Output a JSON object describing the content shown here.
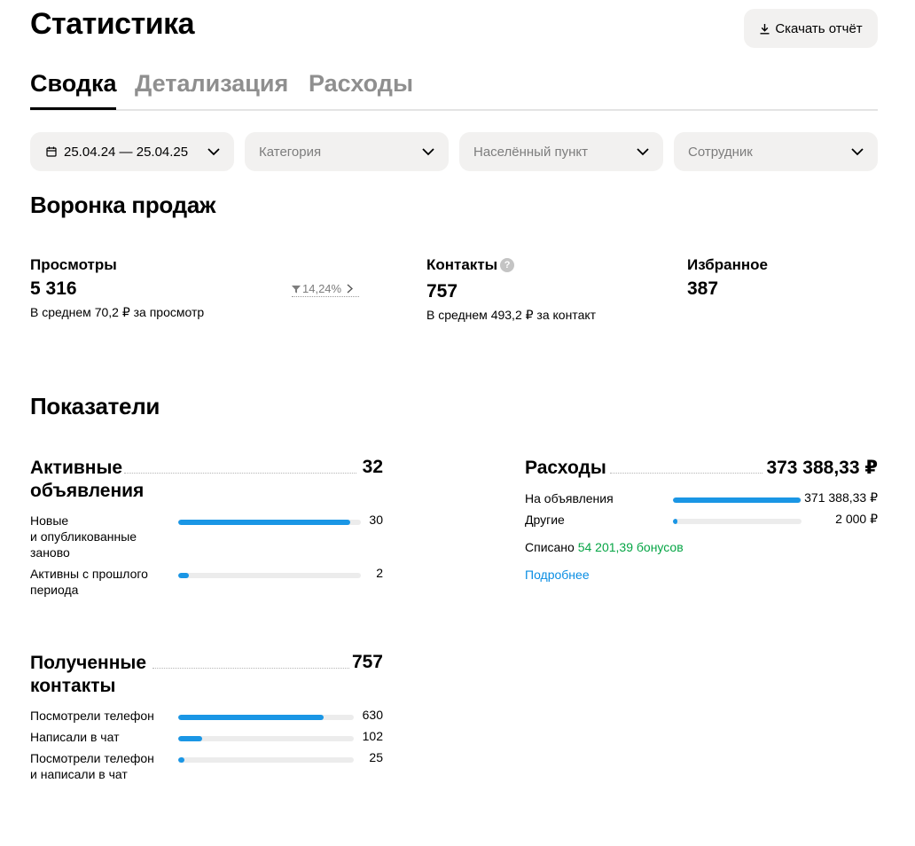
{
  "header": {
    "title": "Статистика",
    "download_label": "Скачать отчёт"
  },
  "tabs": [
    {
      "label": "Сводка",
      "active": true
    },
    {
      "label": "Детализация",
      "active": false
    },
    {
      "label": "Расходы",
      "active": false
    }
  ],
  "filters": {
    "period": "25.04.24 — 25.04.25",
    "category_placeholder": "Категория",
    "city_placeholder": "Населённый пункт",
    "employee_placeholder": "Сотрудник"
  },
  "funnel": {
    "title": "Воронка продаж",
    "views": {
      "label": "Просмотры",
      "value": "5 316",
      "sub": "В среднем 70,2 ₽ за просмотр",
      "conversion": "14,24%"
    },
    "contacts": {
      "label": "Контакты",
      "value": "757",
      "sub": "В среднем 493,2 ₽ за контакт"
    },
    "favorites": {
      "label": "Избранное",
      "value": "387"
    }
  },
  "indicators": {
    "title": "Показатели",
    "active_ads": {
      "title_line1": "Активные",
      "title_line2": "объявления",
      "value": "32",
      "rows": [
        {
          "label_line1": "Новые",
          "label_line2": "и опубликованные",
          "label_line3": "заново",
          "value": "30",
          "share": 0.94
        },
        {
          "label_line1": "Активны с прошлого",
          "label_line2": "периода",
          "value": "2",
          "share": 0.06
        }
      ]
    },
    "received_contacts": {
      "title_line1": "Полученные",
      "title_line2": "контакты",
      "value": "757",
      "rows": [
        {
          "label_line1": "Посмотрели телефон",
          "value": "630",
          "share": 0.83
        },
        {
          "label_line1": "Написали в чат",
          "value": "102",
          "share": 0.135
        },
        {
          "label_line1": "Посмотрели телефон",
          "label_line2": "и написали в чат",
          "value": "25",
          "share": 0.033
        }
      ]
    },
    "expenses": {
      "title": "Расходы",
      "value": "373 388,33 ₽",
      "rows": [
        {
          "label": "На объявления",
          "value": "371 388,33 ₽",
          "share": 0.995
        },
        {
          "label": "Другие",
          "value": "2 000 ₽",
          "share": 0.035
        }
      ],
      "written_off_label": "Списано",
      "written_off_value": "54 201,39 бонусов",
      "more_link": "Подробнее"
    }
  },
  "colors": {
    "accent_bar": "#1a96e5",
    "bonus_green": "#06a545",
    "link_blue": "#0a8ee3"
  },
  "icons": [
    "download-icon",
    "calendar-icon",
    "chevron-down-icon",
    "help-icon",
    "filter-funnel-icon",
    "chevron-right-icon"
  ]
}
